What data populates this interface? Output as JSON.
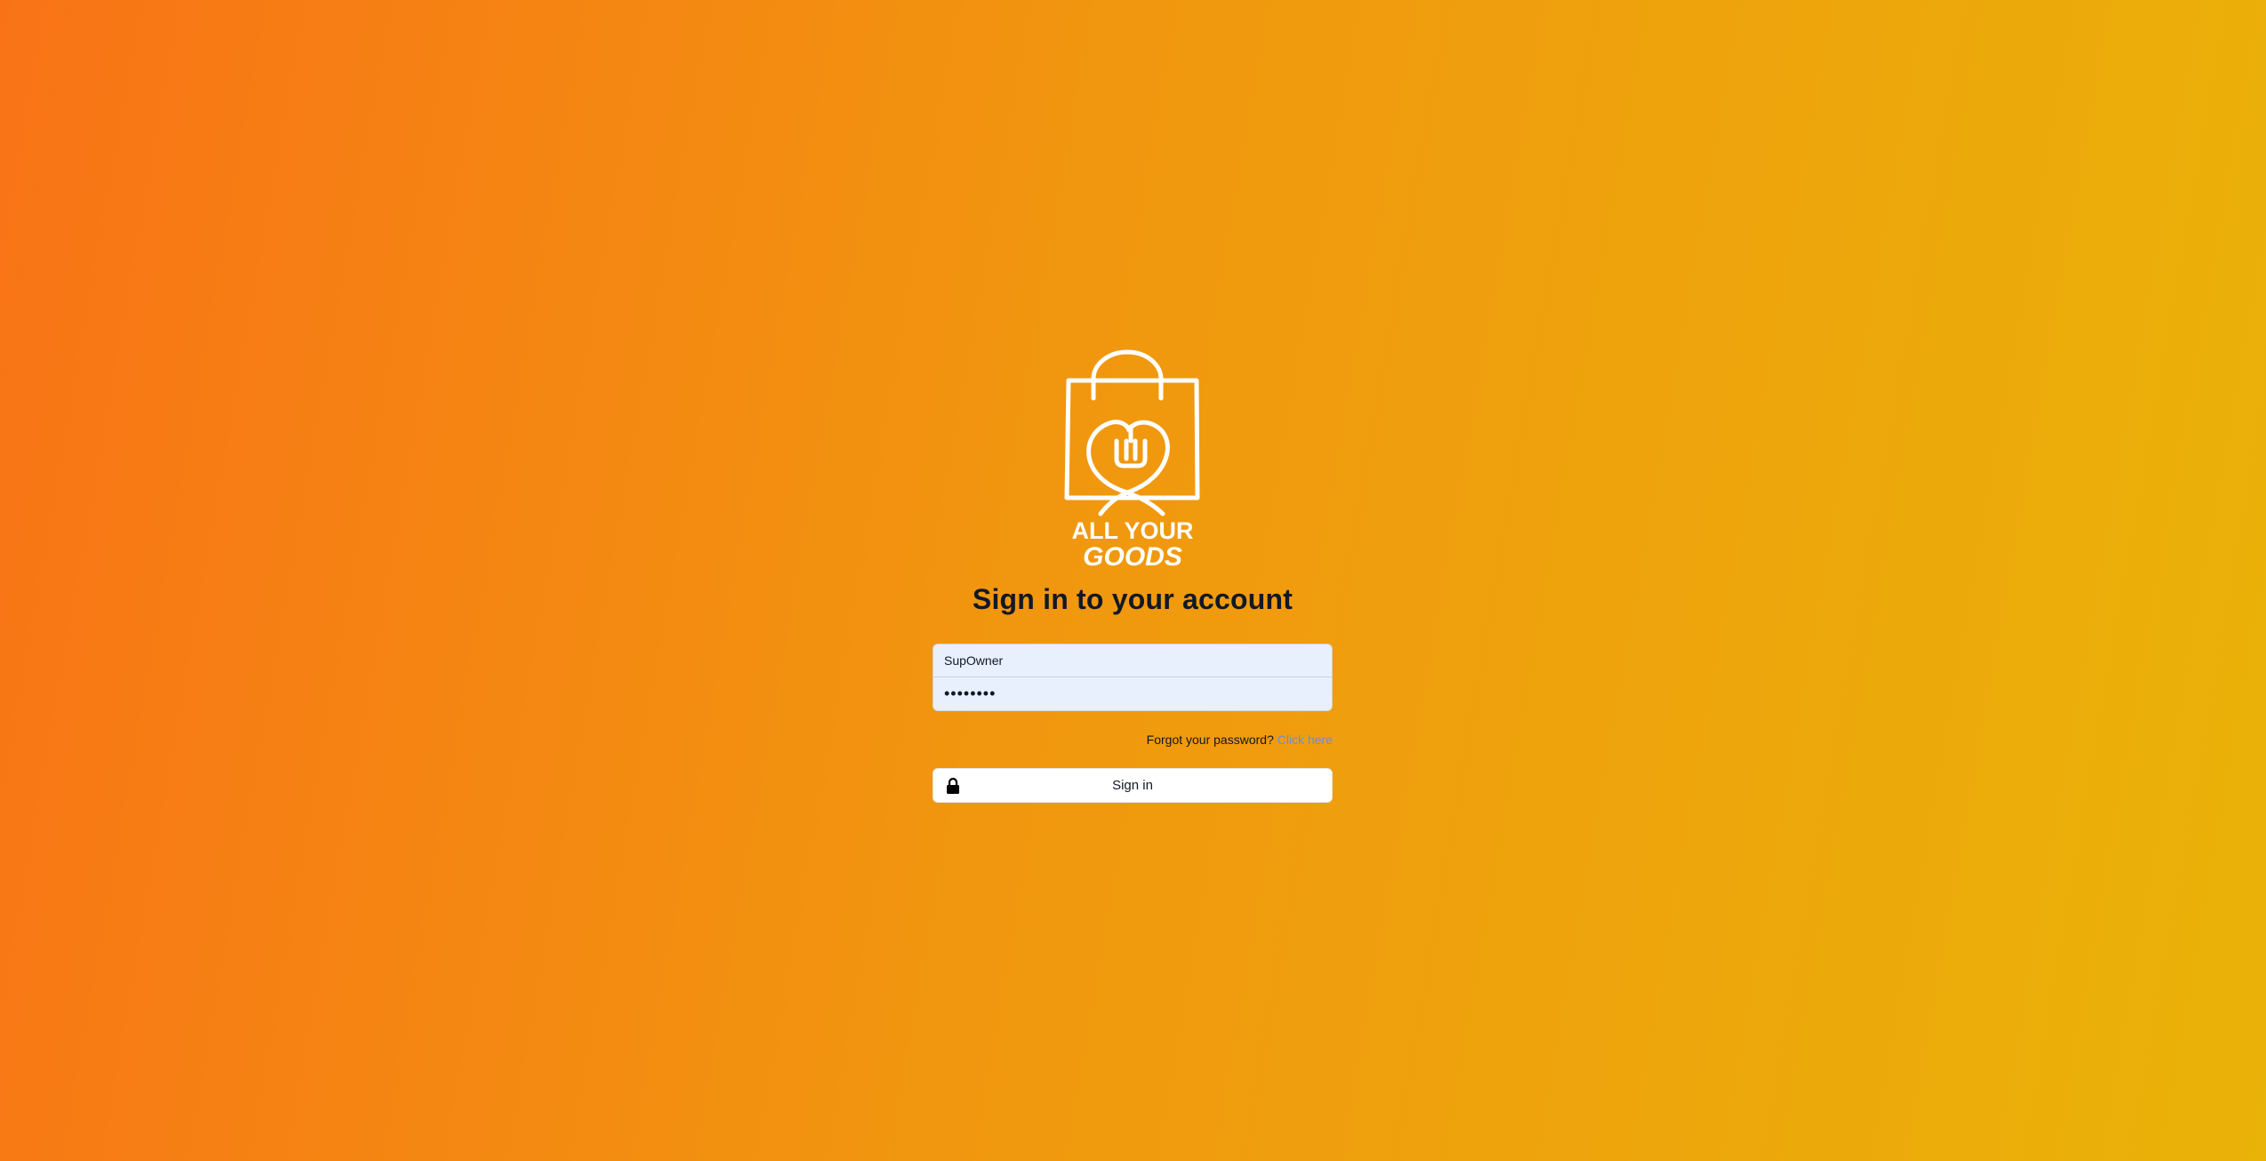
{
  "brand": {
    "logo_line1": "ALL YOUR",
    "logo_line2": "GOODS"
  },
  "login": {
    "title": "Sign in to your account",
    "username_value": "SupOwner",
    "password_value": "••••••••",
    "forgot_text": "Forgot your password?",
    "forgot_link": "Click here",
    "signin_label": "Sign in"
  },
  "icons": {
    "logo": "shopping-bag-fork-logo",
    "lock": "lock-icon"
  },
  "colors": {
    "gradient_start": "#f97316",
    "gradient_end": "#eab308",
    "input_bg": "#e8f0fe",
    "link": "#6b8fd6"
  }
}
